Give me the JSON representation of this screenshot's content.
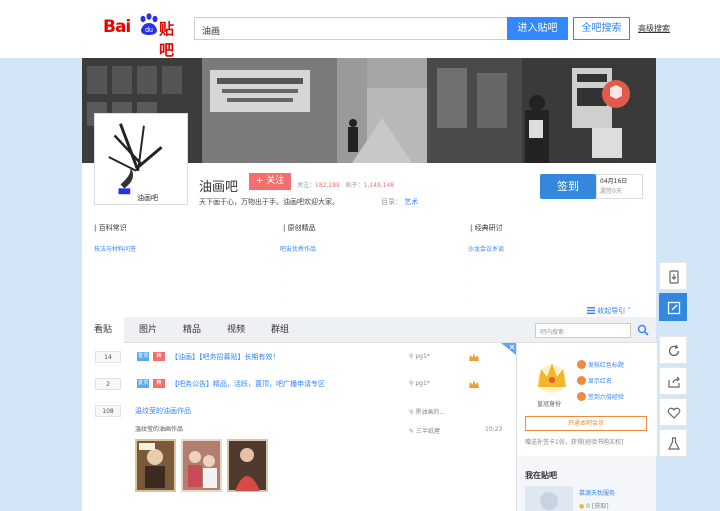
{
  "header": {
    "logo_bai": "Bai",
    "logo_du": "du",
    "logo_tieba": "贴吧",
    "search_value": "油画",
    "enter_button": "进入贴吧",
    "all_search_button": "全吧搜索",
    "advanced_search": "高级搜索"
  },
  "forum": {
    "name": "油画吧",
    "follow_label": "+ 关注",
    "follow_prefix": "关注：",
    "follow_count": "182,289",
    "posts_prefix": "贴子：",
    "posts_count": "1,149,148",
    "slogan": "天下画于心，万物出于手。油画吧欢迎大家。",
    "dir_prefix": "目录：",
    "dir_value": "艺术",
    "avatar_caption": "油画吧",
    "sign_button": "签到",
    "sign_date": "04月16日",
    "sign_streak_prefix": "漏签",
    "sign_streak_value": "0",
    "sign_streak_suffix": "天"
  },
  "groups": [
    {
      "title": "| 百科常识",
      "link": "技法与材料问答"
    },
    {
      "title": "| 原创精品",
      "link": "吧友优秀作品"
    },
    {
      "title": "| 经典研讨",
      "link": "沙龙会议乡谈"
    }
  ],
  "fold_label": "收起导引",
  "tabs": [
    "看贴",
    "图片",
    "精品",
    "视频",
    "群组"
  ],
  "tab_search_placeholder": "吧内搜索",
  "threads": [
    {
      "count": "14",
      "badges": [
        "置顶",
        "精"
      ],
      "title": "【油画】【吧务招募贴】长期有效！",
      "author": "pg1*"
    },
    {
      "count": "2",
      "badges": [
        "置顶",
        "精"
      ],
      "title": "【吧务公告】精品，活跃，置顶，吧广播申请专区",
      "author": "pg1*"
    },
    {
      "count": "108",
      "badges": [],
      "title": "温纹莹的油画作品",
      "subtitle": "温纹莹的油画作品",
      "author": "黑油画的...",
      "last_reply": "三半纸屋",
      "time": "10:23"
    }
  ],
  "sidebar": {
    "crown_label": "皇冠身份",
    "perks": [
      "发帖红色标题",
      "显示红名",
      "签到六倍经验"
    ],
    "open_button": "开通本吧会员",
    "promo": "赠送补签卡1张，获得[经验书购买权]",
    "my_forum_title": "我在贴吧",
    "user_name": "慕源天枕服务",
    "user_meta": "0 [获取]"
  },
  "colors": {
    "brand_red": "#e10602",
    "accent_blue": "#3388ff",
    "link_blue": "#3385ff",
    "follow_red": "#f56e6e"
  }
}
